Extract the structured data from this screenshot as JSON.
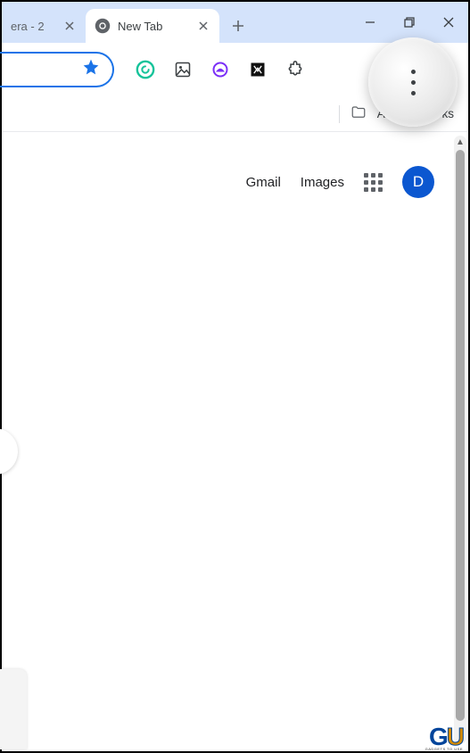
{
  "tabs": {
    "inactive": {
      "title": "era - 2"
    },
    "active": {
      "title": "New Tab"
    }
  },
  "toolbar": {
    "download_visible": true
  },
  "bookmarks": {
    "all_label": "All Bookmarks"
  },
  "ntp": {
    "gmail": "Gmail",
    "images": "Images",
    "avatar_letter": "D"
  },
  "watermark": {
    "g": "G",
    "u": "U",
    "sub": "GADGETS TO USE"
  }
}
